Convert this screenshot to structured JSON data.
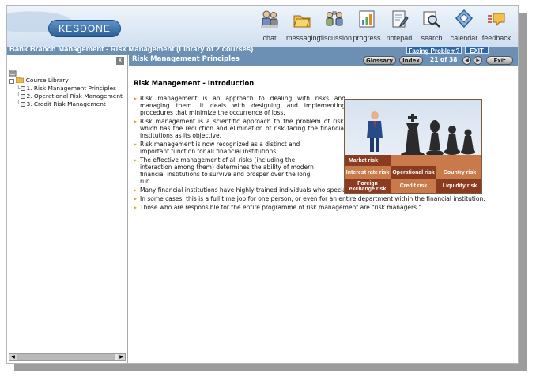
{
  "app": {
    "logo_text": "KESDONE",
    "window_title": "Bank Branch Management - Risk Management (Library of 2 courses)",
    "facing_problem_label": "Facing Problem?",
    "exit_label": "EXIT"
  },
  "toolbar": {
    "items": [
      {
        "label": "chat",
        "icon": "chat-icon"
      },
      {
        "label": "messaging",
        "icon": "messaging-icon"
      },
      {
        "label": "discussion",
        "icon": "discussion-icon"
      },
      {
        "label": "progress",
        "icon": "progress-icon"
      },
      {
        "label": "notepad",
        "icon": "notepad-icon"
      },
      {
        "label": "search",
        "icon": "search-icon"
      },
      {
        "label": "calendar",
        "icon": "calendar-icon"
      },
      {
        "label": "feedback",
        "icon": "feedback-icon"
      }
    ]
  },
  "sidebar": {
    "close_label": "X",
    "library_label": "Course Library",
    "courses": [
      {
        "label": "1. Risk Management Principles"
      },
      {
        "label": "2. Operational Risk Management"
      },
      {
        "label": "3. Credit Risk Management"
      }
    ]
  },
  "content": {
    "section_title": "Risk Management Principles",
    "glossary_label": "Glossary",
    "index_label": "Index",
    "page_indicator": "21 of 38",
    "exit_label": "Exit",
    "heading": "Risk Management - Introduction",
    "bullets_narrow": [
      "Risk management is an approach to dealing with risks and managing them. It deals with designing and implementing procedures that minimize the occurrence of loss.",
      "Risk management is a scientific approach to the problem of risk, which has the reduction and elimination of risk facing the financial institutions as its objective.",
      "Risk management is now recognized as a distinct and important function for all financial institutions.",
      "The effective management of all risks (including the interaction among them) determines the ability of modern financial institutions to survive and prosper over the long run."
    ],
    "bullets_wide": [
      "Many financial institutions have highly trained individuals who specialize in dealing with risk.",
      "In some cases, this is a full time job for one person, or even for an entire department within the financial institution.",
      "Those who are responsible for the entire programme of risk management are \"risk managers.\""
    ],
    "graphic": {
      "market_risk": "Market risk",
      "interest_rate_risk": "Interest rate risk",
      "operational_risk": "Operational risk",
      "country_risk": "Country risk",
      "foreign_exchange_risk": "Foreign exchange risk",
      "credit_risk": "Credit risk",
      "liquidity_risk": "Liquidity risk"
    }
  },
  "colors": {
    "title_bar": "#6c8fb4",
    "bullet": "#e89a1b",
    "board_dark": "#8b3b1f",
    "board_light": "#c97a4a"
  }
}
